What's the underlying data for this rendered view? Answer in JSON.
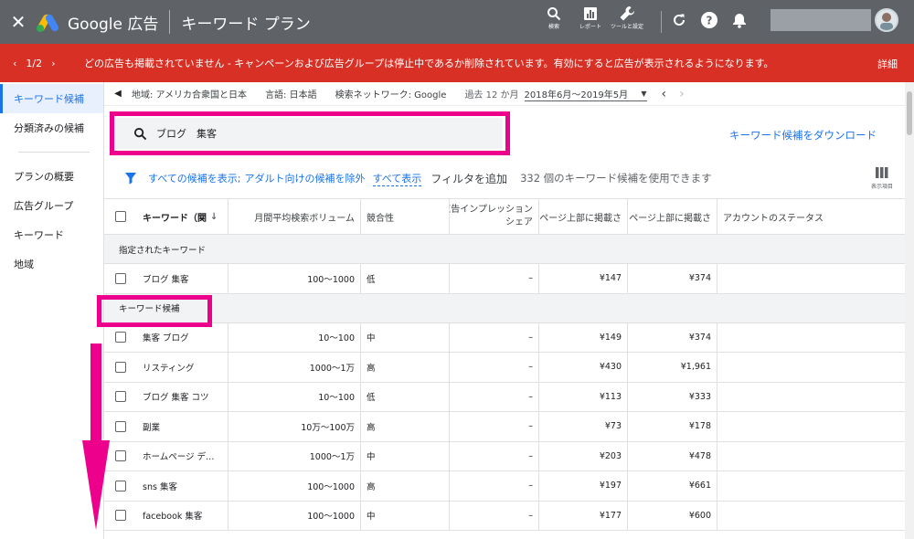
{
  "topbar": {
    "brand": "Google 広告",
    "page_title": "キーワード プラン",
    "tools": [
      {
        "label": "検索",
        "icon": "search-icon"
      },
      {
        "label": "レポート",
        "icon": "report-icon"
      },
      {
        "label": "ツールと設定",
        "icon": "wrench-icon"
      }
    ]
  },
  "alert": {
    "pager": "1/2",
    "message": "どの広告も掲載されていません - キャンペーンおよび広告グループは停止中であるか削除されています。有効にすると広告が表示されるようになります。",
    "detail": "詳細"
  },
  "sidebar": {
    "items": [
      {
        "label": "キーワード候補",
        "active": true
      },
      {
        "label": "分類済みの候補"
      },
      {
        "label": "プランの概要"
      },
      {
        "label": "広告グループ"
      },
      {
        "label": "キーワード"
      },
      {
        "label": "地域"
      }
    ]
  },
  "filters": {
    "location": "地域: アメリカ合衆国と日本",
    "language": "言語: 日本語",
    "network": "検索ネットワーク: Google",
    "period_label": "過去 12 か月",
    "period_value": "2018年6月～2019年5月"
  },
  "search": {
    "query": "ブログ　集客"
  },
  "download_link": "キーワード候補をダウンロード",
  "filter_row": {
    "show_all_candidates": "すべての候補を表示;",
    "exclude_adult": "アダルト向けの候補を除外",
    "show_all": "すべて表示",
    "add_filter": "フィルタを追加",
    "count_text": "332 個のキーワード候補を使用できます",
    "columns_label": "表示項目"
  },
  "table": {
    "headers": {
      "keyword": "キーワード（関",
      "volume": "月間平均検索ボリューム",
      "competition": "競合性",
      "impression_1": "広告インプレッション",
      "impression_2": "シェア",
      "bid_low": "ページ上部に掲載さ",
      "bid_high": "ページ上部に掲載さ",
      "account_status": "アカウントのステータス"
    },
    "section_specified": "指定されたキーワード",
    "specified_rows": [
      {
        "keyword": "ブログ 集客",
        "volume": "100～1000",
        "competition": "低",
        "impression": "–",
        "low": "¥147",
        "high": "¥374"
      }
    ],
    "section_candidates": "キーワード候補",
    "candidate_rows": [
      {
        "keyword": "集客 ブログ",
        "volume": "10～100",
        "competition": "中",
        "impression": "–",
        "low": "¥149",
        "high": "¥374"
      },
      {
        "keyword": "リスティング",
        "volume": "1000～1万",
        "competition": "高",
        "impression": "–",
        "low": "¥430",
        "high": "¥1,961"
      },
      {
        "keyword": "ブログ 集客 コツ",
        "volume": "10～100",
        "competition": "低",
        "impression": "–",
        "low": "¥113",
        "high": "¥333"
      },
      {
        "keyword": "副業",
        "volume": "10万～100万",
        "competition": "高",
        "impression": "–",
        "low": "¥73",
        "high": "¥178"
      },
      {
        "keyword": "ホームページ デ…",
        "volume": "1000～1万",
        "competition": "中",
        "impression": "–",
        "low": "¥203",
        "high": "¥478"
      },
      {
        "keyword": "sns 集客",
        "volume": "100～1000",
        "competition": "高",
        "impression": "–",
        "low": "¥197",
        "high": "¥661"
      },
      {
        "keyword": "facebook 集客",
        "volume": "100～1000",
        "competition": "中",
        "impression": "–",
        "low": "¥177",
        "high": "¥600"
      }
    ]
  },
  "colors": {
    "accent": "#1a73e8",
    "alert": "#d93025",
    "highlight": "#ec008c",
    "topbar": "#5f6368"
  }
}
